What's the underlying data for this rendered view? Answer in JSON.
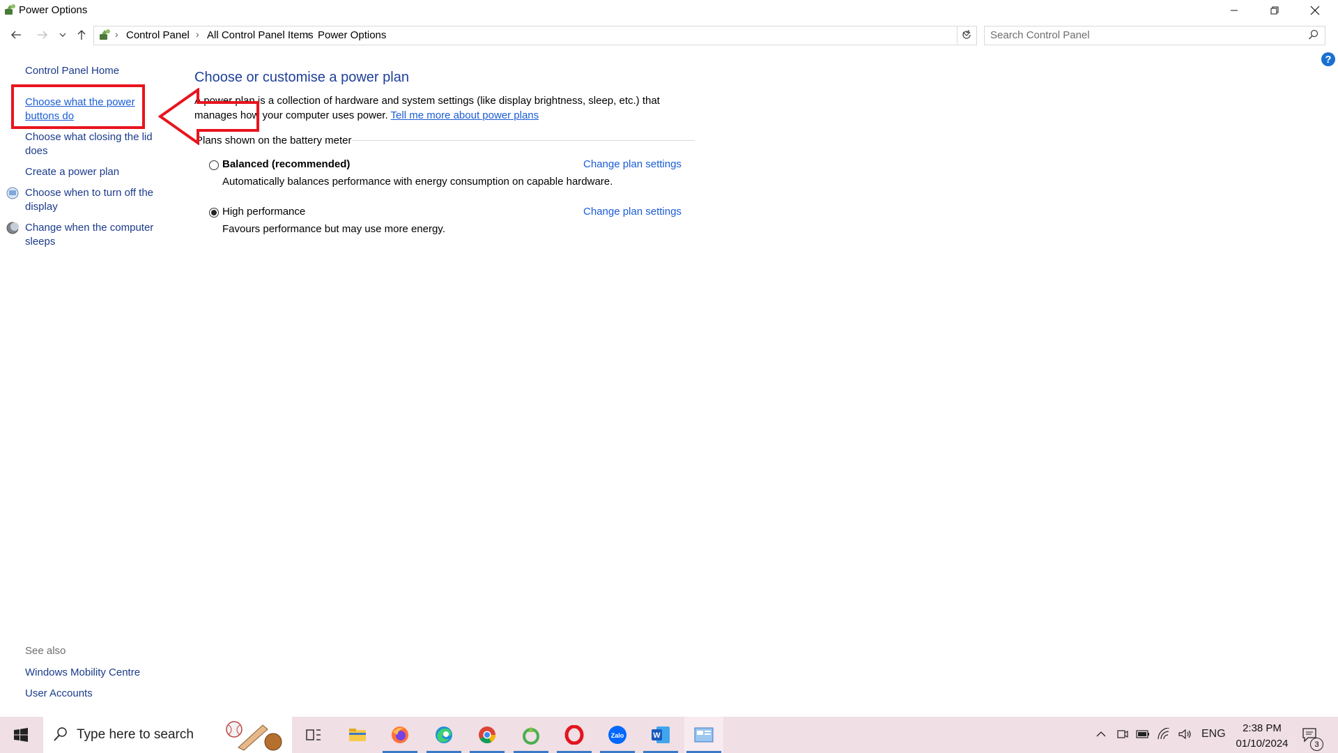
{
  "window": {
    "title": "Power Options"
  },
  "address": {
    "crumbs": [
      "Control Panel",
      "All Control Panel Items",
      "Power Options"
    ]
  },
  "search": {
    "placeholder": "Search Control Panel"
  },
  "sidebar": {
    "home": "Control Panel Home",
    "items": [
      {
        "label_line1": "Choose what the power",
        "label_line2": "buttons do"
      },
      {
        "label_line1": "Choose what closing the lid",
        "label_line2": "does"
      },
      {
        "label_line1": "Create a power plan"
      },
      {
        "label_line1": "Choose when to turn off the",
        "label_line2": "display"
      },
      {
        "label_line1": "Change when the computer",
        "label_line2": "sleeps"
      }
    ],
    "see_also": "See also",
    "see_also_items": [
      "Windows Mobility Centre",
      "User Accounts"
    ]
  },
  "main": {
    "title": "Choose or customise a power plan",
    "intro_line1": "A power plan is a collection of hardware and system settings (like display brightness, sleep, etc.) that",
    "intro_line2": "manages how your computer uses power. ",
    "intro_link": "Tell me more about power plans",
    "group_label": "Plans shown on the battery meter",
    "plans": [
      {
        "name": "Balanced (recommended)",
        "description": "Automatically balances performance with energy consumption on capable hardware.",
        "link": "Change plan settings",
        "selected": false
      },
      {
        "name": "High performance",
        "description": "Favours performance but may use more energy.",
        "link": "Change plan settings",
        "selected": true
      }
    ]
  },
  "taskbar": {
    "search_placeholder": "Type here to search",
    "language": "ENG",
    "time": "2:38 PM",
    "date": "01/10/2024",
    "notification_count": "3"
  },
  "colors": {
    "accent": "#1a5cd6",
    "annotation": "#e8141d",
    "taskbar": "#f0dfe4"
  }
}
